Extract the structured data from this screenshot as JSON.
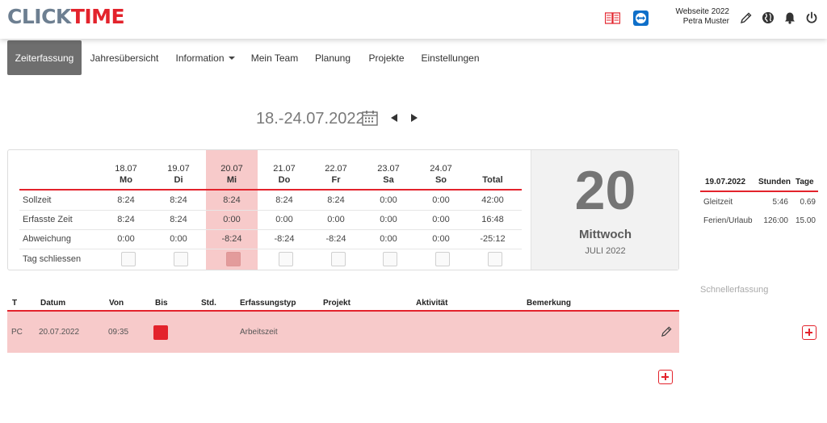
{
  "app": {
    "logo_part1": "CLICK",
    "logo_part2": "TIME",
    "brand_color": "#e3232c"
  },
  "header": {
    "user_line1": "Webseite 2022",
    "user_line2": "Petra Muster",
    "icons": [
      "book-icon",
      "teamviewer-icon",
      "pencil-icon",
      "globe-icon",
      "bell-icon",
      "power-icon"
    ]
  },
  "nav": {
    "tabs": [
      {
        "label": "Zeiterfassung",
        "active": true
      },
      {
        "label": "Jahresübersicht"
      },
      {
        "label": "Information"
      },
      {
        "label": "Mein Team"
      },
      {
        "label": "Planung"
      },
      {
        "label": "Projekte"
      },
      {
        "label": "Einstellungen"
      }
    ]
  },
  "week": {
    "range": "18.-24.07.2022"
  },
  "days": [
    {
      "date": "18.07",
      "day": "Mo",
      "soll": "8:24",
      "erfasst": "8:24",
      "abw": "0:00"
    },
    {
      "date": "19.07",
      "day": "Di",
      "soll": "8:24",
      "erfasst": "8:24",
      "abw": "0:00"
    },
    {
      "date": "20.07",
      "day": "Mi",
      "soll": "8:24",
      "erfasst": "0:00",
      "abw": "-8:24"
    },
    {
      "date": "21.07",
      "day": "Do",
      "soll": "8:24",
      "erfasst": "0:00",
      "abw": "-8:24"
    },
    {
      "date": "22.07",
      "day": "Fr",
      "soll": "8:24",
      "erfasst": "0:00",
      "abw": "-8:24"
    },
    {
      "date": "23.07",
      "day": "Sa",
      "soll": "0:00",
      "erfasst": "0:00",
      "abw": "0:00"
    },
    {
      "date": "24.07",
      "day": "So",
      "soll": "0:00",
      "erfasst": "0:00",
      "abw": "0:00"
    }
  ],
  "total": {
    "label": "Total",
    "soll": "42:00",
    "erfasst": "16:48",
    "abw": "-25:12"
  },
  "row_labels": {
    "soll": "Sollzeit",
    "erfasst": "Erfasste Zeit",
    "abw": "Abweichung",
    "close": "Tag schliessen"
  },
  "today": {
    "number": "20",
    "weekday": "Mittwoch",
    "month": "JULI 2022"
  },
  "balances": {
    "date": "19.07.2022",
    "col_hours": "Stunden",
    "col_days": "Tage",
    "rows": [
      {
        "label": "Gleitzeit",
        "hours": "5:46",
        "days": "0.69"
      },
      {
        "label": "Ferien/Urlaub",
        "hours": "126:00",
        "days": "15.00"
      }
    ]
  },
  "entries": {
    "columns": [
      "T",
      "Datum",
      "Von",
      "Bis",
      "Std.",
      "Erfassungstyp",
      "Projekt",
      "Aktivität",
      "Bemerkung"
    ],
    "rows": [
      {
        "t": "PC",
        "datum": "20.07.2022",
        "von": "09:35",
        "bis": "",
        "std": "",
        "typ": "Arbeitszeit",
        "projekt": "",
        "aktivitaet": "",
        "bemerkung": ""
      }
    ]
  },
  "quick_entry": {
    "label": "Schnellerfassung"
  }
}
